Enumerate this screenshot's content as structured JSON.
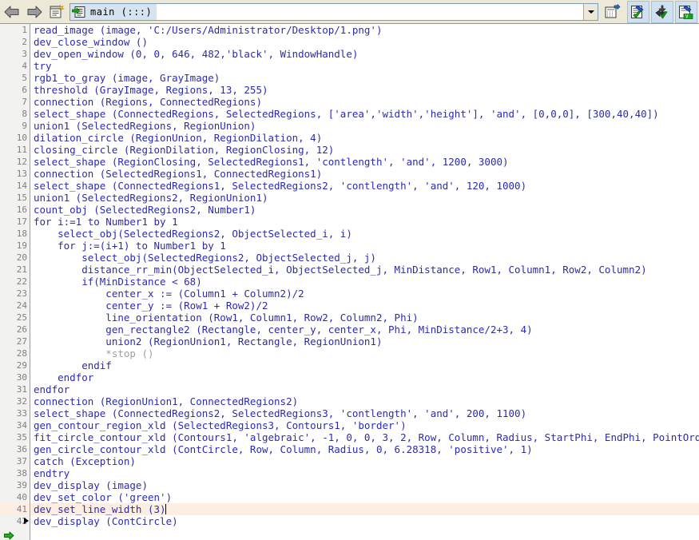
{
  "toolbar": {
    "back_label": "Back",
    "forward_label": "Forward",
    "procedures_label": "New Procedure",
    "combo": {
      "value": "main (:::)",
      "icon": "procedure-icon"
    },
    "insert_label": "Insert Operator",
    "buttons_right": [
      {
        "name": "execute-line-button",
        "label": "Execute Line"
      },
      {
        "name": "step-over-button",
        "label": "Step Over"
      },
      {
        "name": "step-into-button",
        "label": "Step Into"
      }
    ]
  },
  "editor": {
    "current_line": 41,
    "pc_line": 42,
    "lines": [
      {
        "n": 1,
        "text": "read_image (image, 'C:/Users/Administrator/Desktop/1.png')"
      },
      {
        "n": 2,
        "text": "dev_close_window ()"
      },
      {
        "n": 3,
        "text": "dev_open_window (0, 0, 646, 482,'black', WindowHandle)"
      },
      {
        "n": 4,
        "text": "try"
      },
      {
        "n": 5,
        "text": "rgb1_to_gray (image, GrayImage)"
      },
      {
        "n": 6,
        "text": "threshold (GrayImage, Regions, 13, 255)"
      },
      {
        "n": 7,
        "text": "connection (Regions, ConnectedRegions)"
      },
      {
        "n": 8,
        "text": "select_shape (ConnectedRegions, SelectedRegions, ['area','width','height'], 'and', [0,0,0], [300,40,40])"
      },
      {
        "n": 9,
        "text": "union1 (SelectedRegions, RegionUnion)"
      },
      {
        "n": 10,
        "text": "dilation_circle (RegionUnion, RegionDilation, 4)"
      },
      {
        "n": 11,
        "text": "closing_circle (RegionDilation, RegionClosing, 12)"
      },
      {
        "n": 12,
        "text": "select_shape (RegionClosing, SelectedRegions1, 'contlength', 'and', 1200, 3000)"
      },
      {
        "n": 13,
        "text": "connection (SelectedRegions1, ConnectedRegions1)"
      },
      {
        "n": 14,
        "text": "select_shape (ConnectedRegions1, SelectedRegions2, 'contlength', 'and', 120, 1000)"
      },
      {
        "n": 15,
        "text": "union1 (SelectedRegions2, RegionUnion1)"
      },
      {
        "n": 16,
        "text": "count_obj (SelectedRegions2, Number1)"
      },
      {
        "n": 17,
        "text": "for i:=1 to Number1 by 1"
      },
      {
        "n": 18,
        "text": "    select_obj(SelectedRegions2, ObjectSelected_i, i)"
      },
      {
        "n": 19,
        "text": "    for j:=(i+1) to Number1 by 1"
      },
      {
        "n": 20,
        "text": "        select_obj(SelectedRegions2, ObjectSelected_j, j)"
      },
      {
        "n": 21,
        "text": "        distance_rr_min(ObjectSelected_i, ObjectSelected_j, MinDistance, Row1, Column1, Row2, Column2)"
      },
      {
        "n": 22,
        "text": "        if(MinDistance < 68)"
      },
      {
        "n": 23,
        "text": "            center_x := (Column1 + Column2)/2"
      },
      {
        "n": 24,
        "text": "            center_y := (Row1 + Row2)/2"
      },
      {
        "n": 25,
        "text": "            line_orientation (Row1, Column1, Row2, Column2, Phi)"
      },
      {
        "n": 26,
        "text": "            gen_rectangle2 (Rectangle, center_y, center_x, Phi, MinDistance/2+3, 4)"
      },
      {
        "n": 27,
        "text": "            union2 (RegionUnion1, Rectangle, RegionUnion1)"
      },
      {
        "n": 28,
        "text": "            *stop ()",
        "comment": true
      },
      {
        "n": 29,
        "text": "        endif"
      },
      {
        "n": 30,
        "text": "    endfor"
      },
      {
        "n": 31,
        "text": "endfor"
      },
      {
        "n": 32,
        "text": "connection (RegionUnion1, ConnectedRegions2)"
      },
      {
        "n": 33,
        "text": "select_shape (ConnectedRegions2, SelectedRegions3, 'contlength', 'and', 200, 1100)"
      },
      {
        "n": 34,
        "text": "gen_contour_region_xld (SelectedRegions3, Contours1, 'border')"
      },
      {
        "n": 35,
        "text": "fit_circle_contour_xld (Contours1, 'algebraic', -1, 0, 0, 3, 2, Row, Column, Radius, StartPhi, EndPhi, PointOrder)"
      },
      {
        "n": 36,
        "text": "gen_circle_contour_xld (ContCircle, Row, Column, Radius, 0, 6.28318, 'positive', 1)"
      },
      {
        "n": 37,
        "text": "catch (Exception)"
      },
      {
        "n": 38,
        "text": "endtry"
      },
      {
        "n": 39,
        "text": "dev_display (image)"
      },
      {
        "n": 40,
        "text": "dev_set_color ('green')"
      },
      {
        "n": 41,
        "text": "dev_set_line_width (3)",
        "current": true
      },
      {
        "n": 42,
        "text": "dev_display (ContCircle)",
        "pc": true
      }
    ]
  },
  "colors": {
    "code_text": "#2b2bb0",
    "comment": "#a0a0a0",
    "gutter_bg": "#f2f2f0",
    "gutter_text": "#808080",
    "current_line_bg": "#fdeee3",
    "toolbar_bg": "#ece9d8",
    "combo_highlight": "#d6e4f2"
  }
}
